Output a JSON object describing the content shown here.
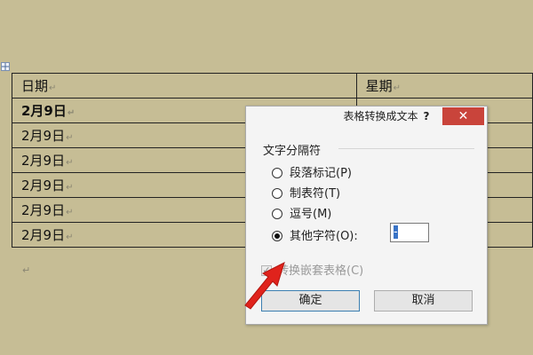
{
  "document": {
    "table": {
      "header": [
        "日期",
        "星期"
      ],
      "rows": [
        {
          "date": "2月9日",
          "bold": true
        },
        {
          "date": "2月9日",
          "bold": false
        },
        {
          "date": "2月9日",
          "bold": false
        },
        {
          "date": "2月9日",
          "bold": false
        },
        {
          "date": "2月9日",
          "bold": false
        },
        {
          "date": "2月9日",
          "bold": false
        }
      ]
    },
    "cell_mark": "↵",
    "paragraph_mark": "↵"
  },
  "dialog": {
    "title": "表格转换成文本",
    "help_label": "?",
    "close_label": "✕",
    "group_label": "文字分隔符",
    "options": [
      {
        "label": "段落标记(P)",
        "checked": false
      },
      {
        "label": "制表符(T)",
        "checked": false
      },
      {
        "label": "逗号(M)",
        "checked": false
      },
      {
        "label": "其他字符(O):",
        "checked": true
      }
    ],
    "other_char_value": "-",
    "nested_checkbox": {
      "label": "转换嵌套表格(C)",
      "checked": true,
      "disabled": true
    },
    "ok_label": "确定",
    "cancel_label": "取消"
  },
  "colors": {
    "background": "#c6bd95",
    "close_button": "#c9443b",
    "arrow": "#e0231c",
    "selection": "#3a74c6"
  }
}
